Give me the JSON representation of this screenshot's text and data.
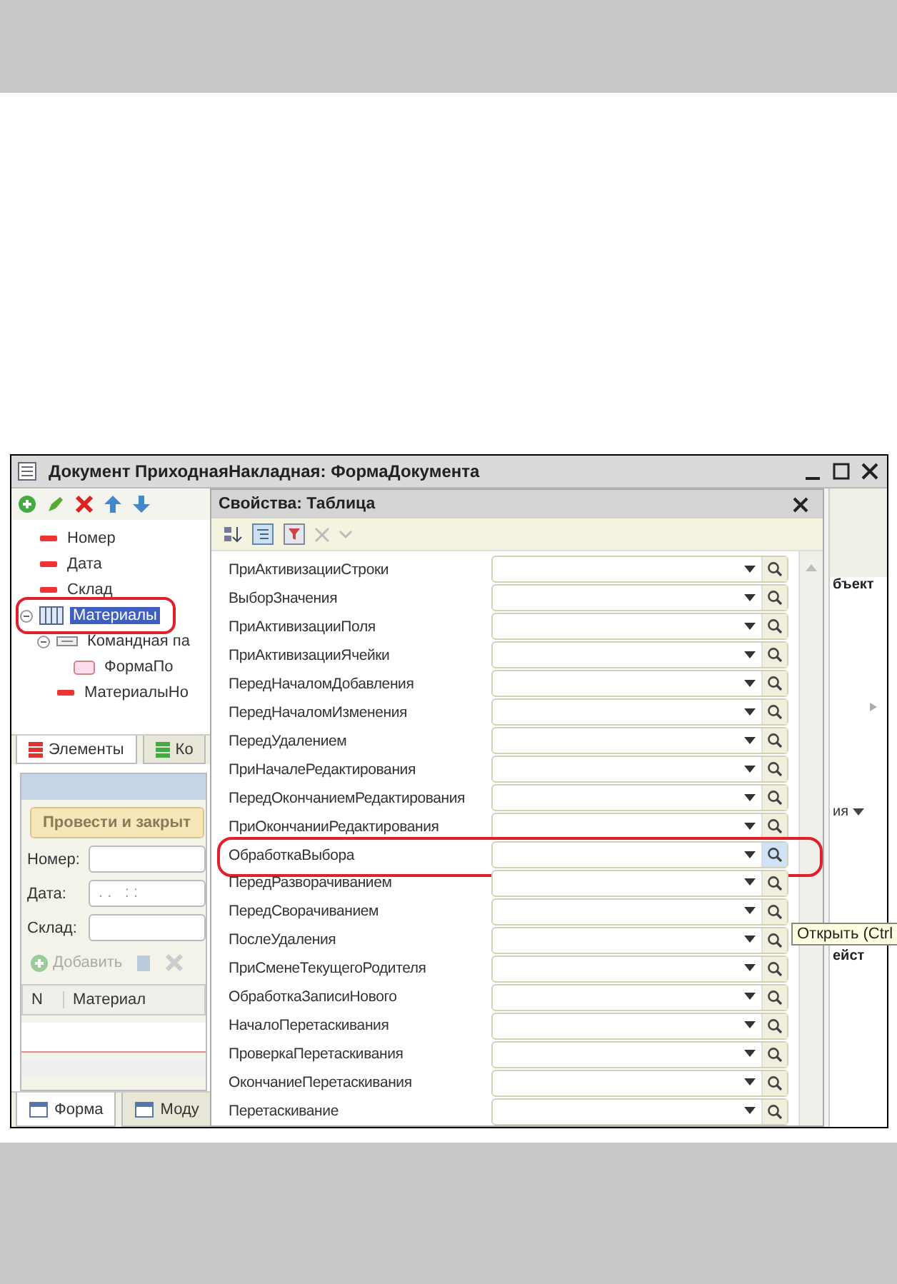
{
  "main_window": {
    "title": "Документ ПриходнаяНакладная: ФормаДокумента"
  },
  "elements_tree": [
    {
      "label": "Номер",
      "kind": "field",
      "selected": false,
      "highlighted": false
    },
    {
      "label": "Дата",
      "kind": "field",
      "selected": false,
      "highlighted": false
    },
    {
      "label": "Склад",
      "kind": "field",
      "selected": false,
      "highlighted": false
    },
    {
      "label": "Материалы",
      "kind": "table",
      "selected": true,
      "highlighted": true,
      "expanded": true,
      "children": [
        {
          "label": "Командная па",
          "kind": "command_bar",
          "selected": false,
          "highlighted": false,
          "expanded": true,
          "children": [
            {
              "label": "ФормаПо",
              "kind": "button",
              "selected": false,
              "highlighted": false
            }
          ]
        },
        {
          "label": "МатериалыНо",
          "kind": "field",
          "selected": false,
          "highlighted": false
        }
      ]
    }
  ],
  "left_tabs": [
    {
      "label": "Элементы",
      "selected": true
    },
    {
      "label": "Ко",
      "selected": false
    }
  ],
  "form_preview": {
    "post_button": "Провести и закрыт",
    "fields": [
      {
        "label": "Номер:"
      },
      {
        "label": "Дата:",
        "value": ". .   : :"
      },
      {
        "label": "Склад:"
      }
    ],
    "add_button": "Добавить",
    "columns": [
      "N",
      "Материал"
    ]
  },
  "bottom_tabs": [
    {
      "label": "Форма",
      "selected": true
    },
    {
      "label": "Моду",
      "selected": false
    }
  ],
  "right_column": {
    "text_1": "бъект",
    "text_2": "ия",
    "text_3": "ейст"
  },
  "properties": {
    "title": "Свойства: Таблица",
    "rows": [
      {
        "name": "ПриАктивизацииСтроки",
        "highlighted": false
      },
      {
        "name": "ВыборЗначения",
        "highlighted": false
      },
      {
        "name": "ПриАктивизацииПоля",
        "highlighted": false
      },
      {
        "name": "ПриАктивизацииЯчейки",
        "highlighted": false
      },
      {
        "name": "ПередНачаломДобавления",
        "highlighted": false
      },
      {
        "name": "ПередНачаломИзменения",
        "highlighted": false
      },
      {
        "name": "ПередУдалением",
        "highlighted": false
      },
      {
        "name": "ПриНачалеРедактирования",
        "highlighted": false
      },
      {
        "name": "ПередОкончаниемРедактирования",
        "highlighted": false
      },
      {
        "name": "ПриОкончанииРедактирования",
        "highlighted": false
      },
      {
        "name": "ОбработкаВыбора",
        "highlighted": true
      },
      {
        "name": "ПередРазворачиванием",
        "highlighted": false
      },
      {
        "name": "ПередСворачиванием",
        "highlighted": false
      },
      {
        "name": "ПослеУдаления",
        "highlighted": false
      },
      {
        "name": "ПриСменеТекущегоРодителя",
        "highlighted": false
      },
      {
        "name": "ОбработкаЗаписиНового",
        "highlighted": false
      },
      {
        "name": "НачалоПеретаскивания",
        "highlighted": false
      },
      {
        "name": "ПроверкаПеретаскивания",
        "highlighted": false
      },
      {
        "name": "ОкончаниеПеретаскивания",
        "highlighted": false
      },
      {
        "name": "Перетаскивание",
        "highlighted": false
      }
    ]
  },
  "tooltip": "Открыть (Ctrl"
}
